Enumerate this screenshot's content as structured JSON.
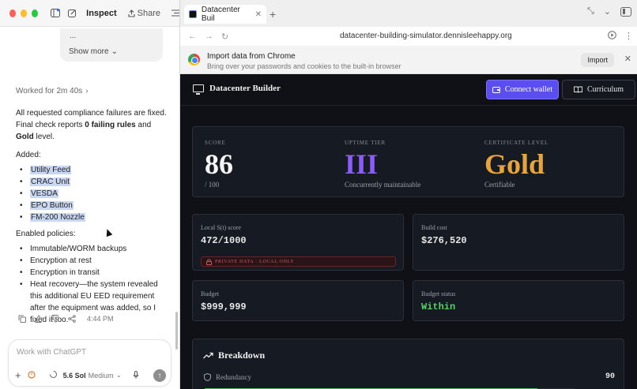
{
  "chat": {
    "title": "Inspect",
    "share_label": "Share",
    "prev_dots": "...",
    "show_more": "Show more",
    "worked_for": "Worked for 2m 40s",
    "intro_1": "All requested compliance failures are fixed. Final check reports ",
    "intro_bold_1": "0 failing rules",
    "intro_2": " and ",
    "intro_bold_2": "Gold",
    "intro_3": " level.",
    "added_heading": "Added:",
    "added_items": [
      "Utility Feed",
      "CRAC Unit",
      "VESDA",
      "EPO Button",
      "FM-200 Nozzle"
    ],
    "policies_heading": "Enabled policies:",
    "policy_items": [
      "Immutable/WORM backups",
      "Encryption at rest",
      "Encryption in transit",
      "Heat recovery—the system revealed this additional EU EED requirement after the equipment was added, so I fixed it too."
    ],
    "timestamp": "4:44 PM",
    "composer_placeholder": "Work with ChatGPT",
    "model_label": "5.6 Sol",
    "effort_label": "Medium"
  },
  "browser": {
    "tab_title": "Datacenter Buil",
    "url": "datacenter-building-simulator.dennisleehappy.org",
    "import_title": "Import data from Chrome",
    "import_sub": "Bring over your passwords and cookies to the built-in browser",
    "import_button": "Import"
  },
  "app": {
    "brand": "Datacenter Builder",
    "connect_wallet": "Connect wallet",
    "curriculum": "Curriculum",
    "score_label": "SCORE",
    "score_value": "86",
    "score_max": "/ 100",
    "uptime_label": "UPTIME TIER",
    "uptime_value": "III",
    "uptime_sub": "Concurrently maintainable",
    "cert_label": "CERTIFICATE LEVEL",
    "cert_value": "Gold",
    "cert_sub": "Certifiable",
    "local_label": "Local S(t) score",
    "local_value": "472/1000",
    "private_tag": "PRIVATE DATA · LOCAL ONLY",
    "build_cost_label": "Build cost",
    "build_cost_value": "$276,520",
    "budget_label": "Budget",
    "budget_value": "$999,999",
    "budget_status_label": "Budget status",
    "budget_status_value": "Within",
    "breakdown_title": "Breakdown",
    "redundancy_label": "Redundancy",
    "redundancy_value": "90",
    "redundancy_fraction": 0.9
  },
  "colors": {
    "accent_purple": "#8b5cf6",
    "gold": "#e8a33a",
    "within_green": "#56d364",
    "wallet_button": "#5b4ef0",
    "progress_green": "#3fbf4f"
  }
}
